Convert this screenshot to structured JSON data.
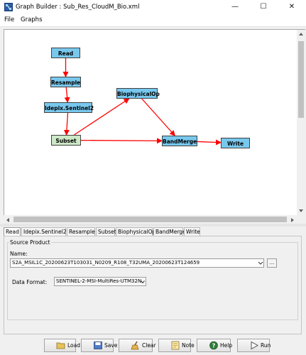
{
  "window": {
    "title": "Graph Builder : Sub_Res_CloudM_Bio.xml"
  },
  "menu": {
    "items": [
      {
        "label": "File"
      },
      {
        "label": "Graphs"
      }
    ]
  },
  "graph": {
    "nodes": [
      {
        "id": "read",
        "label": "Read"
      },
      {
        "id": "resample",
        "label": "Resample"
      },
      {
        "id": "idepix",
        "label": "Idepix.Sentinel2"
      },
      {
        "id": "subset",
        "label": "Subset"
      },
      {
        "id": "biophys",
        "label": "BiophysicalOp"
      },
      {
        "id": "bandmerge",
        "label": "BandMerge"
      },
      {
        "id": "write",
        "label": "Write"
      }
    ],
    "edges": [
      [
        "read",
        "resample"
      ],
      [
        "resample",
        "idepix"
      ],
      [
        "idepix",
        "subset"
      ],
      [
        "subset",
        "biophys"
      ],
      [
        "subset",
        "bandmerge"
      ],
      [
        "biophys",
        "bandmerge"
      ],
      [
        "bandmerge",
        "write"
      ]
    ],
    "edge_color": "#ff0000",
    "node_color": "#78c8ee",
    "selected_node_color": "#cde8c6"
  },
  "tabs": [
    {
      "label": "Read",
      "active": true
    },
    {
      "label": "Idepix.Sentinel2"
    },
    {
      "label": "Resample"
    },
    {
      "label": "Subset"
    },
    {
      "label": "BiophysicalOp"
    },
    {
      "label": "BandMerge"
    },
    {
      "label": "Write"
    }
  ],
  "source_product": {
    "group_title": "Source Product",
    "name_label": "Name:",
    "name_value": "S2A_MSIL1C_20200623T103031_N0209_R108_T32UMA_20200623T124659",
    "browse_label": "..."
  },
  "data_format": {
    "label": "Data Format:",
    "value": "SENTINEL-2-MSI-MultiRes-UTM32N"
  },
  "buttons": {
    "load": "Load",
    "save": "Save",
    "clear": "Clear",
    "note": "Note",
    "help": "Help",
    "run": "Run"
  }
}
